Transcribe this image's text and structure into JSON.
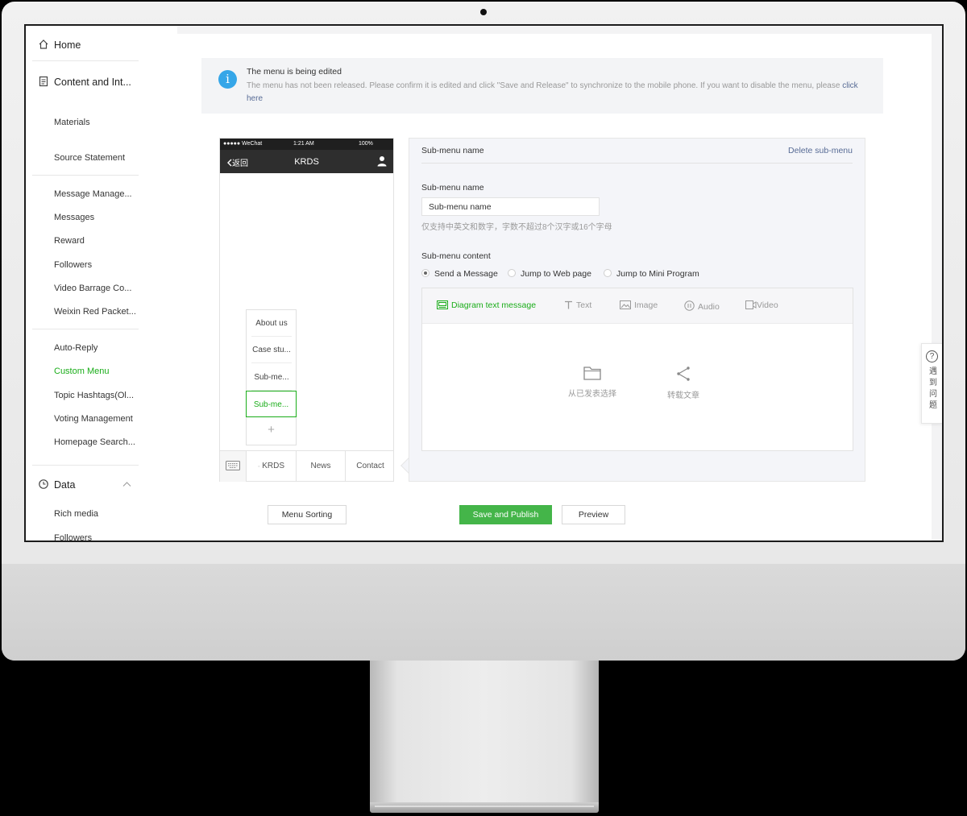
{
  "sidebar": {
    "home": "Home",
    "content_group": "Content and Int...",
    "items_a": [
      "Materials",
      "Source Statement"
    ],
    "items_b": [
      "Message Manage...",
      "Messages",
      "Reward",
      "Followers",
      "Video Barrage Co...",
      "Weixin Red Packet..."
    ],
    "items_c": [
      "Auto-Reply",
      "Custom Menu",
      "Topic Hashtags(Ol...",
      "Voting Management",
      "Homepage Search..."
    ],
    "data_group": "Data",
    "items_d": [
      "Rich media",
      "Followers"
    ],
    "active_item": "Custom Menu"
  },
  "notice": {
    "title": "The menu is being edited",
    "body": "The menu has not been released. Please confirm it is edited and click \"Save and Release\" to synchronize to the mobile phone. If you want to disable the menu, please",
    "link": "click here",
    "icon": "info-icon"
  },
  "phone": {
    "carrier": "●●●●● WeChat",
    "time": "1:21 AM",
    "battery": "100%",
    "back": "返回",
    "title": "KRDS",
    "submenu": [
      "About us",
      "Case stu...",
      "Sub-me...",
      "Sub-me..."
    ],
    "add": "+",
    "bottom_menu": [
      "KRDS",
      "News",
      "Contact"
    ]
  },
  "editor": {
    "header": "Sub-menu name",
    "delete": "Delete sub-menu",
    "name_label": "Sub-menu name",
    "name_value": "Sub-menu name",
    "name_hint": "仅支持中英文和数字，字数不超过8个汉字或16个字母",
    "content_label": "Sub-menu content",
    "radios": [
      "Send a Message",
      "Jump to Web page",
      "Jump to Mini Program"
    ],
    "radio_selected": 0,
    "tabs": [
      "Diagram text message",
      "Text",
      "Image",
      "Audio",
      "Video"
    ],
    "options": [
      "从已发表选择",
      "转载文章"
    ]
  },
  "buttons": {
    "sorting": "Menu Sorting",
    "save": "Save and Publish",
    "preview": "Preview"
  },
  "help": {
    "icon": "?",
    "label": "遇到问题"
  },
  "colors": {
    "accent": "#1aad19",
    "link": "#576b95",
    "info": "#35a6e8",
    "button_green": "#44b549"
  }
}
